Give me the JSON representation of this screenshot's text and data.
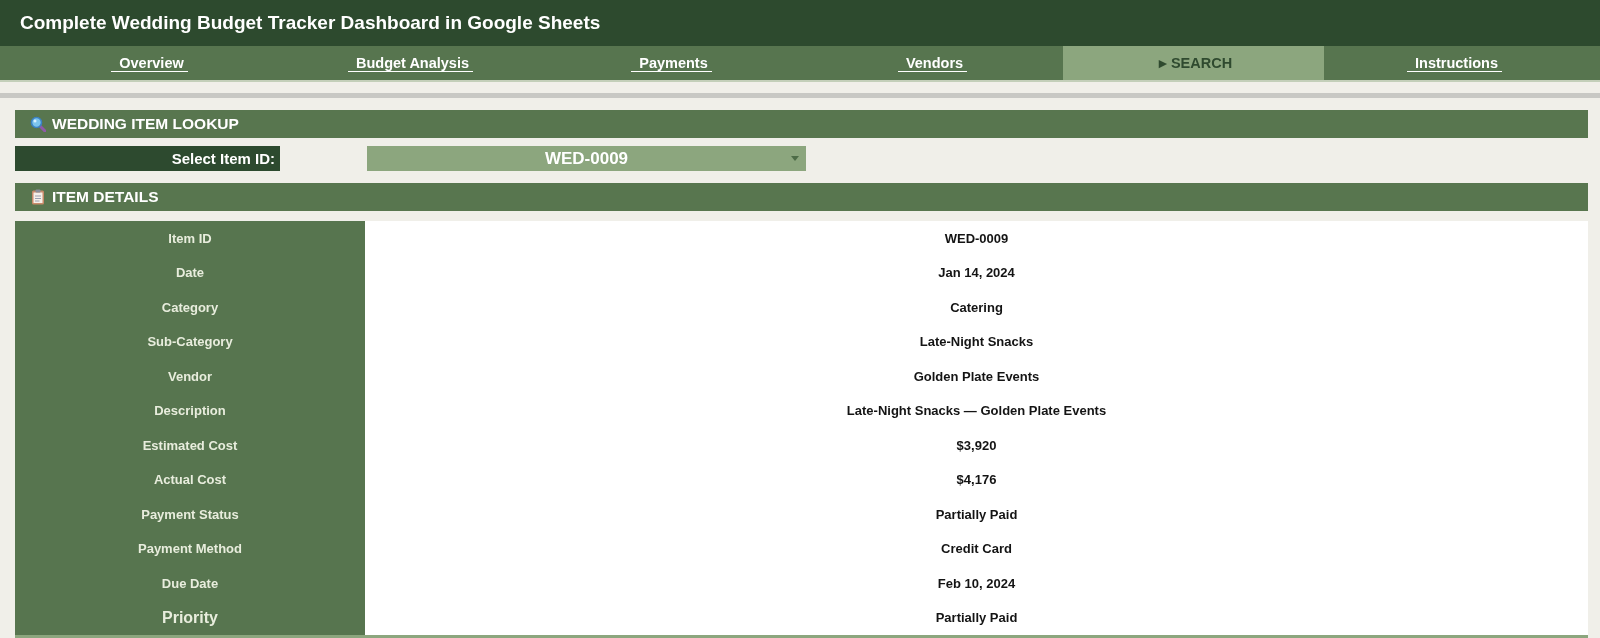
{
  "window": {
    "title": "Complete Wedding Budget Tracker Dashboard in Google Sheets"
  },
  "tabs": [
    {
      "label": "Overview",
      "selected": false
    },
    {
      "label": "Budget Analysis",
      "selected": false
    },
    {
      "label": "Payments",
      "selected": false
    },
    {
      "label": "Vendors",
      "selected": false
    },
    {
      "label": "▸ SEARCH",
      "selected": true
    },
    {
      "label": "Instructions",
      "selected": false
    }
  ],
  "lookup": {
    "heading": "WEDDING ITEM LOOKUP",
    "select_label": "Select Item ID:",
    "selected_id": "WED-0009"
  },
  "details": {
    "heading": "ITEM DETAILS",
    "fields": [
      {
        "label": "Item ID",
        "value": "WED-0009",
        "kind": "standard"
      },
      {
        "label": "Date",
        "value": "Jan 14, 2024",
        "kind": "standard"
      },
      {
        "label": "Category",
        "value": "Catering",
        "kind": "standard"
      },
      {
        "label": "Sub-Category",
        "value": "Late-Night Snacks",
        "kind": "standard"
      },
      {
        "label": "Vendor",
        "value": "Golden Plate Events",
        "kind": "standard"
      },
      {
        "label": "Description",
        "value": "Late-Night Snacks — Golden Plate Events",
        "kind": "standard"
      },
      {
        "label": "Estimated Cost",
        "value": "$3,920",
        "kind": "standard"
      },
      {
        "label": "Actual Cost",
        "value": "$4,176",
        "kind": "standard"
      },
      {
        "label": "Payment Status",
        "value": "Partially Paid",
        "kind": "standard"
      },
      {
        "label": "Payment Method",
        "value": "Credit Card",
        "kind": "standard"
      },
      {
        "label": "Due Date",
        "value": "Feb 10, 2024",
        "kind": "standard"
      },
      {
        "label": "Priority",
        "value": "Partially Paid",
        "kind": "large"
      }
    ]
  }
}
